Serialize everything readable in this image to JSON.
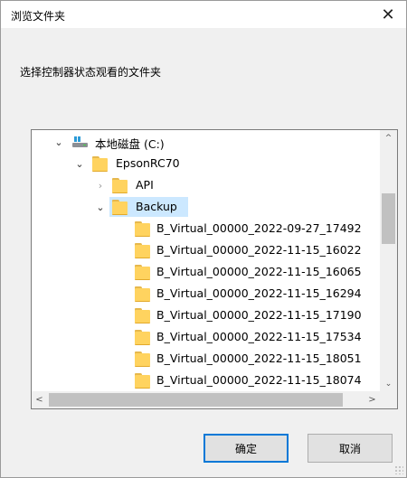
{
  "dialog": {
    "title": "浏览文件夹",
    "close_glyph": "✕",
    "instruction": "选择控制器状态观看的文件夹"
  },
  "tree": {
    "items": [
      {
        "label": "本地磁盘 (C:)",
        "icon": "drive-icon",
        "expander": "⌄",
        "expanded": true
      },
      {
        "label": "EpsonRC70",
        "icon": "folder-icon",
        "expander": "⌄",
        "expanded": true
      },
      {
        "label": "API",
        "icon": "folder-icon",
        "expander": "›",
        "expanded": false
      },
      {
        "label": "Backup",
        "icon": "folder-icon",
        "expander": "⌄",
        "expanded": true,
        "selected": true
      },
      {
        "label": "B_Virtual_00000_2022-09-27_17492",
        "icon": "folder-icon"
      },
      {
        "label": "B_Virtual_00000_2022-11-15_16022",
        "icon": "folder-icon"
      },
      {
        "label": "B_Virtual_00000_2022-11-15_16065",
        "icon": "folder-icon"
      },
      {
        "label": "B_Virtual_00000_2022-11-15_16294",
        "icon": "folder-icon"
      },
      {
        "label": "B_Virtual_00000_2022-11-15_17190",
        "icon": "folder-icon"
      },
      {
        "label": "B_Virtual_00000_2022-11-15_17534",
        "icon": "folder-icon"
      },
      {
        "label": "B_Virtual_00000_2022-11-15_18051",
        "icon": "folder-icon"
      },
      {
        "label": "B_Virtual_00000_2022-11-15_18074",
        "icon": "folder-icon"
      }
    ]
  },
  "buttons": {
    "ok_label": "确定",
    "cancel_label": "取消"
  },
  "scrollbars": {
    "up": "^",
    "down": "⌄",
    "left": "<",
    "right": ">"
  },
  "colors": {
    "selection": "#cce8ff",
    "default_button_border": "#0078d7",
    "folder": "#ffd35f"
  }
}
